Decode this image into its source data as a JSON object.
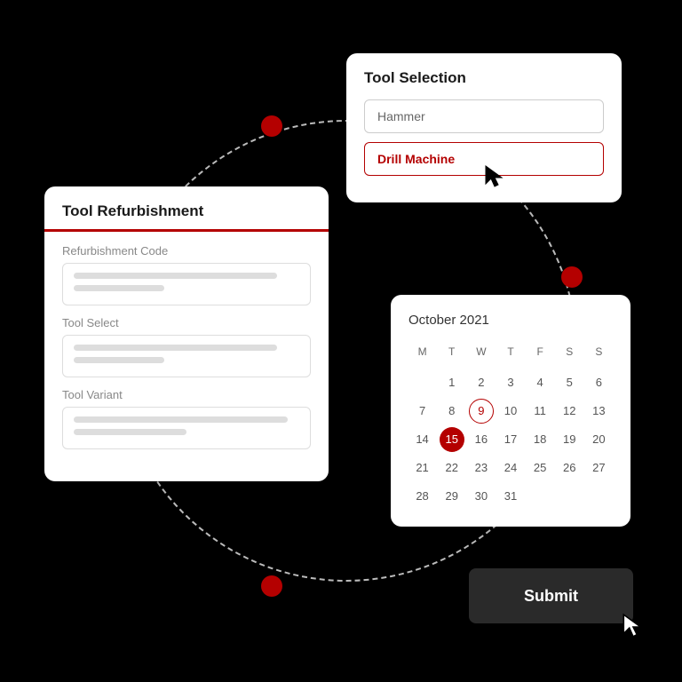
{
  "refurb": {
    "title": "Tool Refurbishment",
    "fields": {
      "code_label": "Refurbishment Code",
      "select_label": "Tool Select",
      "variant_label": "Tool Variant"
    }
  },
  "selection": {
    "title": "Tool Selection",
    "options": {
      "hammer": "Hammer",
      "drill": "Drill Machine"
    }
  },
  "calendar": {
    "month": "October 2021",
    "dow": [
      "M",
      "T",
      "W",
      "T",
      "F",
      "S",
      "S"
    ],
    "today": 9,
    "selected": 15,
    "leading_blanks": 1,
    "days_in_month": 31
  },
  "submit": {
    "label": "Submit"
  },
  "colors": {
    "accent": "#b40000"
  }
}
